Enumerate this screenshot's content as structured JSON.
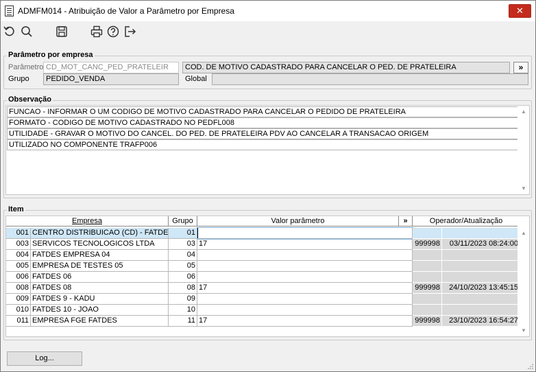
{
  "window": {
    "title": "ADMFM014 - Atribuição de Valor a Parâmetro por Empresa",
    "close_label": "✕"
  },
  "toolbar": {
    "icons": [
      "undo-icon",
      "search-icon",
      "save-icon",
      "print-icon",
      "help-icon",
      "exit-icon"
    ]
  },
  "parametro": {
    "legend": "Parâmetro por empresa",
    "param_label": "Parâmetro",
    "param_value": "CD_MOT_CANC_PED_PRATELEIR",
    "param_description": "COD. DE MOTIVO CADASTRADO PARA CANCELAR O PED. DE PRATELEIRA",
    "expand_label": "»",
    "grupo_label": "Grupo",
    "grupo_value": "PEDIDO_VENDA",
    "global_label": "Global",
    "global_value": ""
  },
  "observacao": {
    "legend": "Observação",
    "lines": [
      "FUNCAO - INFORMAR O UM CODIGO DE MOTIVO CADASTRADO PARA CANCELAR O PEDIDO DE PRATELEIRA",
      "FORMATO - CODIGO DE MOTIVO CADASTRADO NO PEDFL008",
      "UTILIDADE - GRAVAR O MOTIVO DO CANCEL. DO PED. DE PRATELEIRA PDV AO CANCELAR A TRANSACAO ORIGEM",
      "UTILIZADO NO COMPONENTE TRAFP006"
    ]
  },
  "item": {
    "legend": "Item",
    "headers": {
      "empresa": "Empresa",
      "grupo": "Grupo",
      "valor": "Valor parâmetro",
      "expand": "»",
      "operador": "Operador/Atualização"
    },
    "rows": [
      {
        "cod": "001",
        "nome": "CENTRO DISTRIBUICAO (CD) - FATDES",
        "grupo": "01",
        "valor": "",
        "operador": "",
        "data": "",
        "selected": true
      },
      {
        "cod": "003",
        "nome": "SERVICOS TECNOLOGICOS LTDA",
        "grupo": "03",
        "valor": "17",
        "operador": "999998",
        "data": "03/11/2023 08:24:00"
      },
      {
        "cod": "004",
        "nome": "FATDES EMPRESA 04",
        "grupo": "04",
        "valor": "",
        "operador": "",
        "data": ""
      },
      {
        "cod": "005",
        "nome": "EMPRESA DE TESTES 05",
        "grupo": "05",
        "valor": "",
        "operador": "",
        "data": ""
      },
      {
        "cod": "006",
        "nome": "FATDES 06",
        "grupo": "06",
        "valor": "",
        "operador": "",
        "data": ""
      },
      {
        "cod": "008",
        "nome": "FATDES 08",
        "grupo": "08",
        "valor": "17",
        "operador": "999998",
        "data": "24/10/2023 13:45:15"
      },
      {
        "cod": "009",
        "nome": "FATDES 9 - KADU",
        "grupo": "09",
        "valor": "",
        "operador": "",
        "data": ""
      },
      {
        "cod": "010",
        "nome": "FATDES 10 - JOAO",
        "grupo": "10",
        "valor": "",
        "operador": "",
        "data": ""
      },
      {
        "cod": "011",
        "nome": "EMPRESA FGE FATDES",
        "grupo": "11",
        "valor": "17",
        "operador": "999998",
        "data": "23/10/2023 16:54:27"
      }
    ]
  },
  "footer": {
    "log_label": "Log..."
  }
}
